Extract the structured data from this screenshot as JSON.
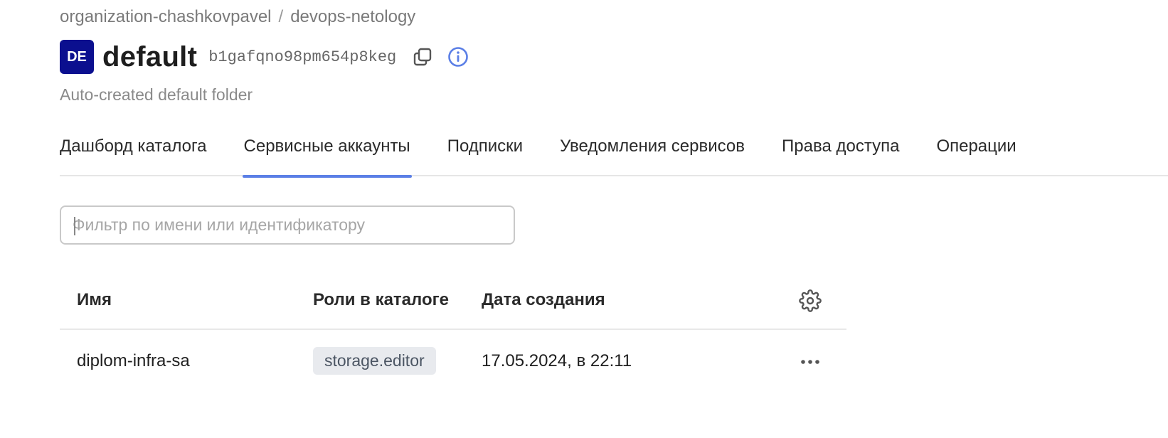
{
  "breadcrumb": {
    "organization": "organization-chashkovpavel",
    "separator": "/",
    "cloud": "devops-netology"
  },
  "folder": {
    "avatar_initials": "DE",
    "name": "default",
    "id": "b1gafqno98pm654p8keg",
    "description": "Auto-created default folder"
  },
  "icons": {
    "copy": "copy-icon",
    "info": "info-icon",
    "settings": "gear-icon",
    "more": "more-horizontal-icon"
  },
  "tabs": [
    {
      "label": "Дашборд каталога",
      "active": false
    },
    {
      "label": "Сервисные аккаунты",
      "active": true
    },
    {
      "label": "Подписки",
      "active": false
    },
    {
      "label": "Уведомления сервисов",
      "active": false
    },
    {
      "label": "Права доступа",
      "active": false
    },
    {
      "label": "Операции",
      "active": false
    }
  ],
  "filter": {
    "placeholder": "Фильтр по имени или идентификатору",
    "value": ""
  },
  "table": {
    "columns": {
      "name": "Имя",
      "roles": "Роли в каталоге",
      "created": "Дата создания"
    },
    "rows": [
      {
        "name": "diplom-infra-sa",
        "role": "storage.editor",
        "created": "17.05.2024, в 22:11"
      }
    ]
  },
  "colors": {
    "accent": "#5b7fe6",
    "avatar_bg": "#0b0f8f",
    "chip_bg": "#e8eaee"
  }
}
